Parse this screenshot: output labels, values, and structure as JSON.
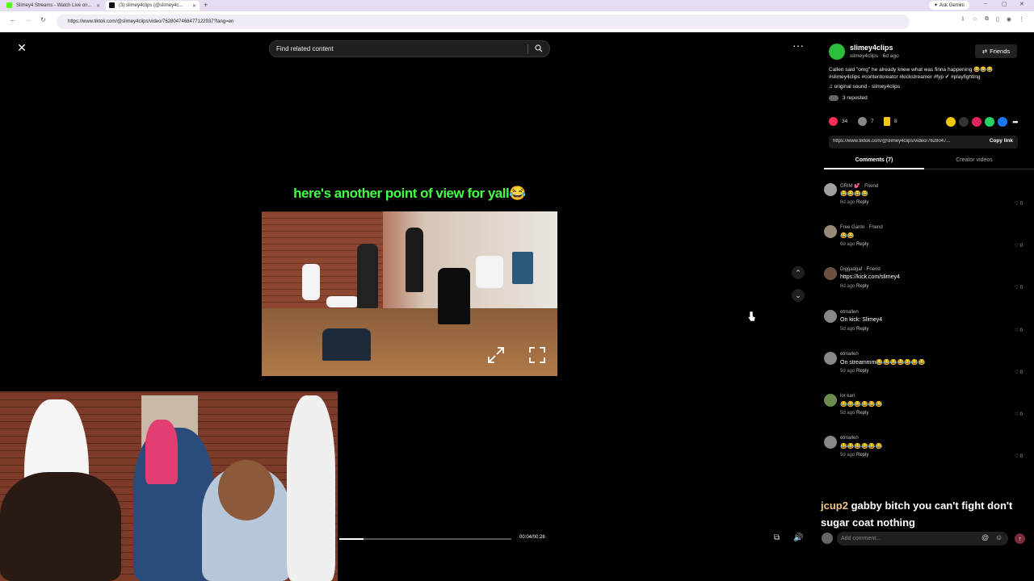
{
  "browser": {
    "tabs": [
      {
        "title": "Slimey4 Streams - Watch Live on..."
      },
      {
        "title": "(3) slimey4clips (@slimey4c..."
      }
    ],
    "new_tab": "+",
    "gemini_label": "Ask Gemini",
    "url": "https://www.tiktok.com/@slimey4clips/video/7628047468477122937?lang=en"
  },
  "player": {
    "search_placeholder": "Find related content",
    "caption": "here's another point of view for yall😂",
    "time": "00:04/00:28",
    "progress": 0.14
  },
  "post": {
    "author": "slimey4clips",
    "author_sub": "slimey4clips · 6d ago",
    "friends_label": "Friends",
    "description": "Callen said \"omg\" he already knew what was finna happening 😂😂😂 #slimey4clips #contentcreator #kickstreamer #fyp ✔ #playfighting",
    "sound": "♫  original sound - slimey4clips",
    "reposted": "3 reposted",
    "likes": "34",
    "comments_count": "7",
    "saves": "8",
    "link": "https://www.tiktok.com/@slimey4clips/video/7628047...",
    "copy_label": "Copy link",
    "tab_comments": "Comments (7)",
    "tab_creator": "Creator videos"
  },
  "comments": [
    {
      "name": "GRIM 💕 · Friend",
      "text": "😂😂😂😂",
      "time": "6d ago",
      "reply": "Reply",
      "likes": "0"
    },
    {
      "name": "Free Ganto · Friend",
      "text": "😂😂",
      "time": "6d ago",
      "reply": "Reply",
      "likes": "0"
    },
    {
      "name": "Diggadgaf · Friend",
      "text": "https://kick.com/slimey4",
      "time": "6d ago",
      "reply": "Reply",
      "likes": "0"
    },
    {
      "name": "otmallen",
      "text": "On kick: Slimey4",
      "time": "5d ago",
      "reply": "Reply",
      "likes": "0"
    },
    {
      "name": "otmallen",
      "text": "On streammm😂😂😂😂😂😂😂",
      "time": "5d ago",
      "reply": "Reply",
      "likes": "0"
    },
    {
      "name": "lor kari",
      "text": "😂😂😂😂😂😂",
      "time": "5d ago",
      "reply": "Reply",
      "likes": "0"
    },
    {
      "name": "otmallen",
      "text": "😂😂😂😂😂😂",
      "time": "5d ago",
      "reply": "Reply",
      "likes": "0"
    }
  ],
  "chat": {
    "user": "jcup2",
    "message": "gabby bitch you can't fight don't sugar coat nothing"
  },
  "comment_input": {
    "placeholder": "Add comment..."
  },
  "colors": {
    "caption": "#44ff44",
    "like": "#fe2c55",
    "chat_user": "#f0c68a"
  }
}
